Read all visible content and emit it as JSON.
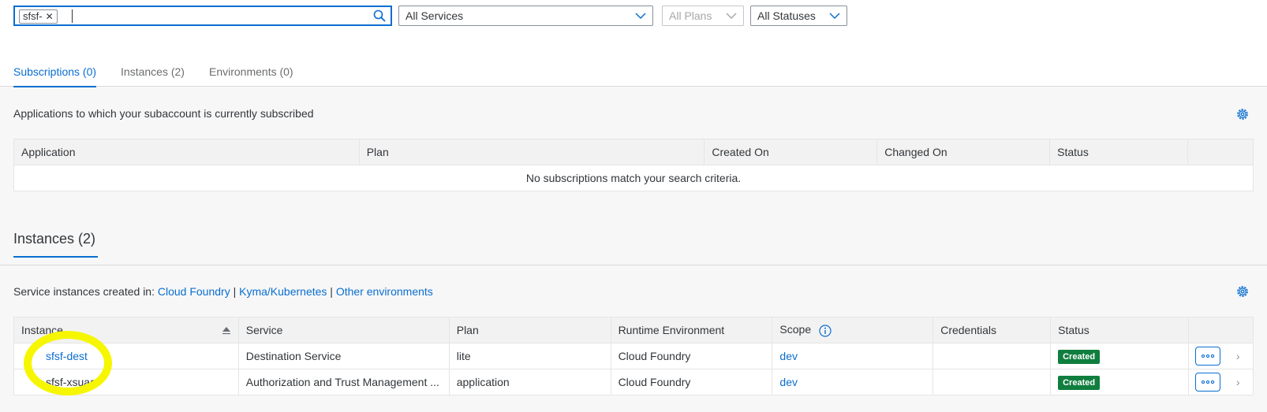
{
  "filters": {
    "search_token": "sfsf-",
    "services": "All Services",
    "plans": "All Plans",
    "statuses": "All Statuses"
  },
  "tabs": [
    {
      "label": "Subscriptions (0)"
    },
    {
      "label": "Instances (2)"
    },
    {
      "label": "Environments (0)"
    }
  ],
  "subscriptions": {
    "description": "Applications to which your subaccount is currently subscribed",
    "columns": [
      "Application",
      "Plan",
      "Created On",
      "Changed On",
      "Status"
    ],
    "empty_text": "No subscriptions match your search criteria."
  },
  "instances": {
    "heading": "Instances (2)",
    "desc_prefix": "Service instances created in: ",
    "env_links": [
      "Cloud Foundry",
      "Kyma/Kubernetes",
      "Other environments"
    ],
    "separator": " | ",
    "columns": [
      "Instance",
      "Service",
      "Plan",
      "Runtime Environment",
      "Scope",
      "Credentials",
      "Status"
    ],
    "rows": [
      {
        "instance": "sfsf-dest",
        "service": "Destination Service",
        "plan": "lite",
        "runtime": "Cloud Foundry",
        "scope": "dev",
        "credentials": "",
        "status": "Created"
      },
      {
        "instance": "sfsf-xsuaa",
        "service": "Authorization and Trust Management ...",
        "plan": "application",
        "runtime": "Cloud Foundry",
        "scope": "dev",
        "credentials": "",
        "status": "Created"
      }
    ]
  },
  "colors": {
    "accent": "#0a6ed1",
    "success": "#107e3e",
    "highlight": "#f6f600"
  },
  "icons": [
    "search-icon",
    "token-close-icon",
    "chevron-down-icon",
    "gear-icon",
    "sort-icon",
    "info-icon",
    "more-icon",
    "chevron-right-icon"
  ]
}
